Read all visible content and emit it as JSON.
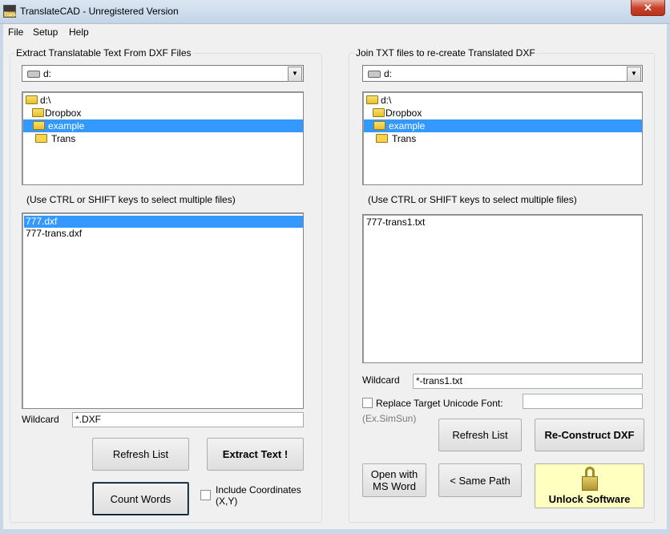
{
  "window": {
    "title": "TranslateCAD - Unregistered Version",
    "icon_text": "Trans"
  },
  "menu": {
    "file": "File",
    "setup": "Setup",
    "help": "Help"
  },
  "left": {
    "group_title": "Extract Translatable Text From DXF Files",
    "drive": "d:",
    "tree": [
      {
        "label": "d:\\",
        "selected": false
      },
      {
        "label": "Dropbox",
        "selected": false
      },
      {
        "label": "example",
        "selected": true
      },
      {
        "label": "Trans",
        "selected": false
      }
    ],
    "hint": "(Use CTRL or SHIFT keys to select multiple files)",
    "files": [
      {
        "label": "777.dxf",
        "selected": true
      },
      {
        "label": "777-trans.dxf",
        "selected": false
      }
    ],
    "wildcard_label": "Wildcard",
    "wildcard_value": "*.DXF",
    "refresh_button": "Refresh List",
    "extract_button": "Extract Text !",
    "count_button": "Count Words",
    "include_coords_line1": "Include Coordinates",
    "include_coords_line2": "(X,Y)",
    "include_coords_checked": false
  },
  "right": {
    "group_title": "Join TXT files to re-create Translated DXF",
    "drive": "d:",
    "tree": [
      {
        "label": "d:\\",
        "selected": false
      },
      {
        "label": "Dropbox",
        "selected": false
      },
      {
        "label": "example",
        "selected": true
      },
      {
        "label": "Trans",
        "selected": false
      }
    ],
    "hint": "(Use CTRL or SHIFT keys to select multiple files)",
    "files": [
      {
        "label": "777-trans1.txt",
        "selected": false
      }
    ],
    "wildcard_label": "Wildcard",
    "wildcard_value": "*-trans1.txt",
    "replace_font_label": "Replace Target Unicode Font:",
    "replace_font_checked": false,
    "replace_font_value": "",
    "font_example": "(Ex.SimSun)",
    "refresh_button": "Refresh List",
    "reconstruct_button": "Re-Construct DXF",
    "open_ms_word_line1": "Open with",
    "open_ms_word_line2": "MS Word",
    "same_path_button": "< Same Path",
    "unlock_button": "Unlock Software"
  },
  "colors": {
    "selection": "#3399ff",
    "unlock_bg": "#ffffc0",
    "window_face": "#f0f0f0"
  }
}
